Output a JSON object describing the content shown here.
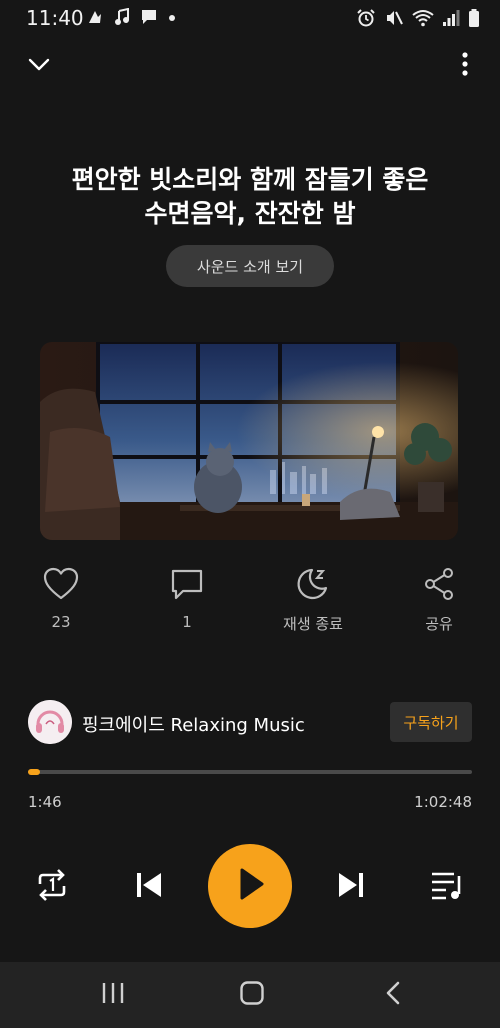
{
  "status_bar": {
    "time": "11:40",
    "left_icons": [
      "app-notification-icon",
      "music-note-icon",
      "message-icon",
      "dot-icon"
    ],
    "right_icons": [
      "alarm-icon",
      "mute-icon",
      "wifi-icon",
      "signal-icon",
      "battery-icon"
    ]
  },
  "header": {
    "title_line1": "편안한 빗소리와 함께 잠들기 좋은",
    "title_line2": "수면음악, 잔잔한 밤",
    "intro_button": "사운드 소개 보기"
  },
  "actions": {
    "like_count": "23",
    "comment_count": "1",
    "sleep_timer_label": "재생 종료",
    "share_label": "공유"
  },
  "channel": {
    "name": "핑크에이드 Relaxing Music",
    "subscribe_label": "구독하기"
  },
  "player": {
    "current_time": "1:46",
    "total_time": "1:02:48",
    "progress_fraction": 0.028
  },
  "colors": {
    "accent": "#f7a21b",
    "background": "#161616"
  }
}
